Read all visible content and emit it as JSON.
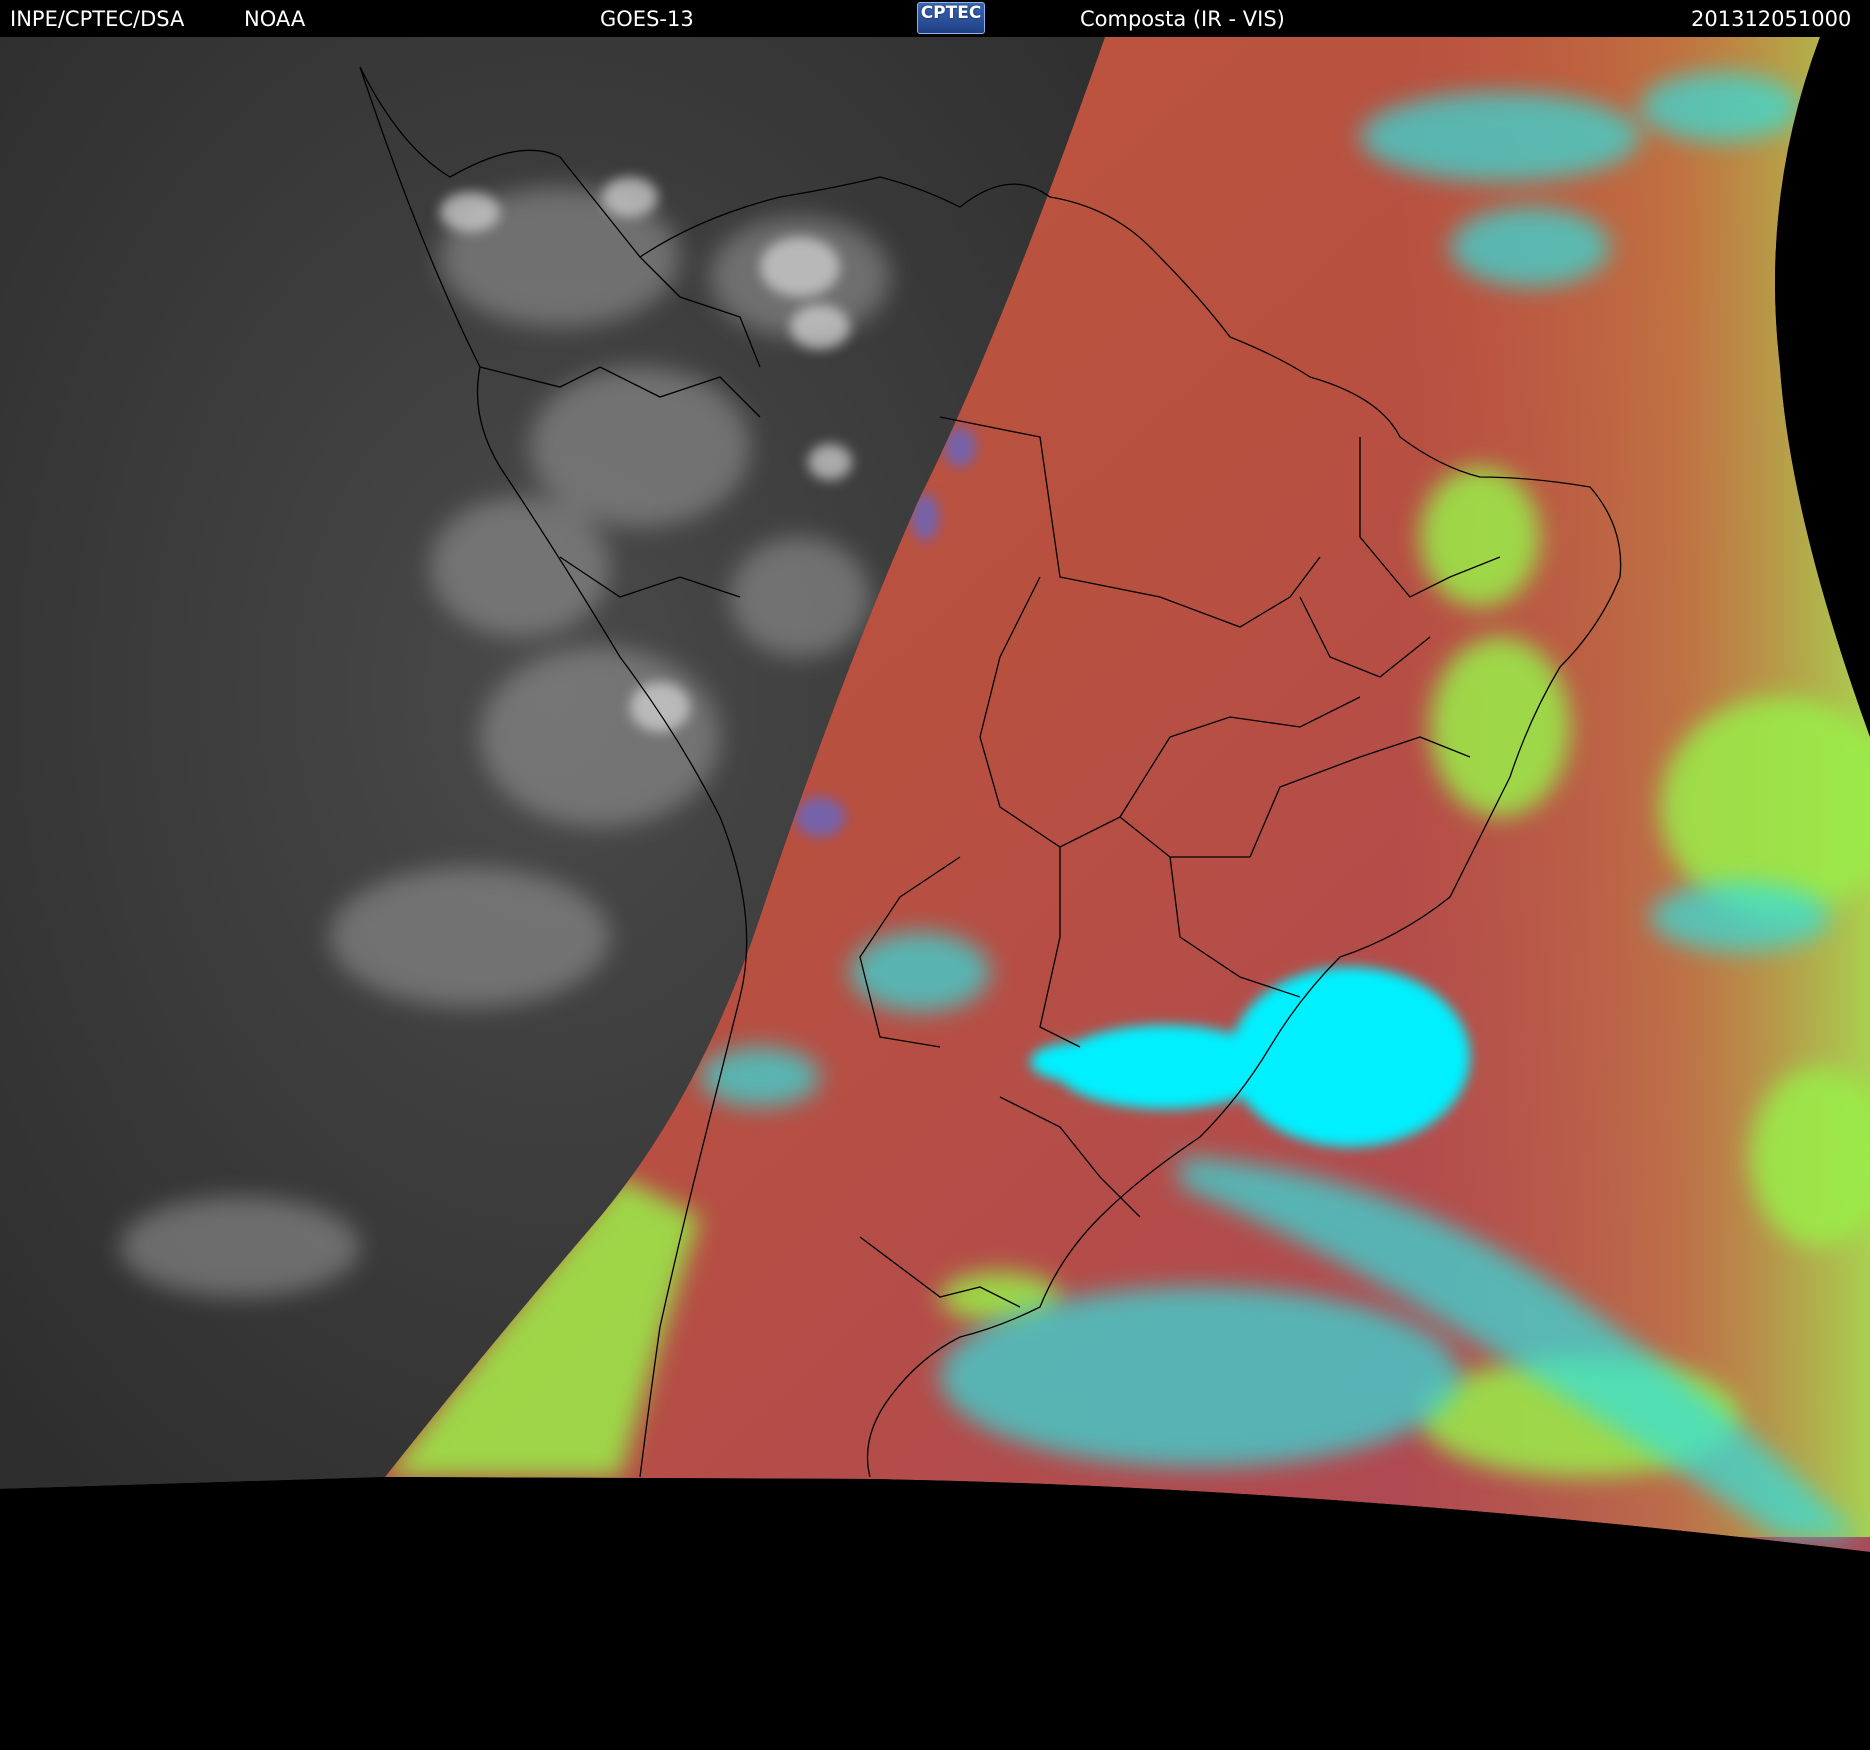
{
  "header": {
    "source": "INPE/CPTEC/DSA",
    "agency": "NOAA",
    "satellite": "GOES-13",
    "logo_text": "CPTEC",
    "product": "Composta (IR - VIS)",
    "timestamp": "201312051000"
  },
  "colors": {
    "background": "#000000",
    "night_ir_gray": "#3a3a3a",
    "land_red": "#b4503c",
    "ocean_red": "#c0584a",
    "cloud_cyan": "#00e8f4",
    "low_cloud_green": "#9aee4a",
    "mixed_blue": "#5a6ad8",
    "borders": "#000000"
  },
  "image_description_layers": [
    "infrared-night-side",
    "composite-day-side",
    "country-borders",
    "state-borders"
  ]
}
